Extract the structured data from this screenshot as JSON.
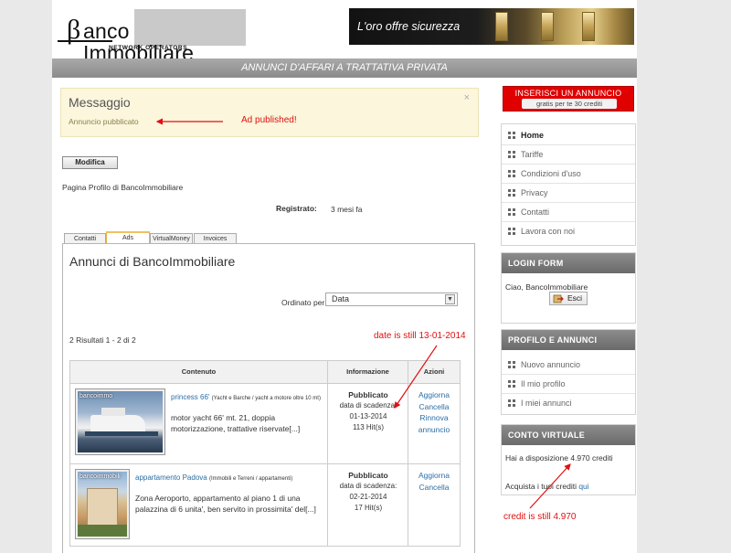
{
  "header": {
    "logo_b": "β",
    "logo_text": "anco Immobiliare",
    "logo_sub": "NETWORK OPERATORS",
    "banner_text": "L'oro offre sicurezza"
  },
  "page_title": "ANNUNCI D'AFFARI A TRATTATIVA PRIVATA",
  "message": {
    "title": "Messaggio",
    "text": "Annuncio pubblicato",
    "close": "×"
  },
  "annotations": {
    "published": "Ad published!",
    "date": "date is still 13-01-2014",
    "credit": "credit is still 4.970"
  },
  "profile": {
    "edit_button": "Modifica",
    "page_text": "Pagina Profilo di BancoImmobiliare",
    "registered_label": "Registrato:",
    "registered_value": "3 mesi fa"
  },
  "tabs": [
    {
      "label": "Contatti"
    },
    {
      "label": "Ads"
    },
    {
      "label": "VirtualMoney"
    },
    {
      "label": "Invoices"
    }
  ],
  "ads": {
    "title": "Annunci di BancoImmobiliare",
    "order_label": "Ordinato per",
    "order_value": "Data",
    "results": "2 Risultati 1 - 2 di 2",
    "headers": [
      "Contenuto",
      "Informazione",
      "Azioni"
    ],
    "rows": [
      {
        "watermark": "bancoimmo",
        "title": "princess 66'",
        "category": "(Yacht e Barche / yacht a motore oltre 10 mt)",
        "desc1": "motor yacht 66' mt. 21, doppia",
        "desc2": "motorizzazione, trattative riservate[...]",
        "status": "Pubblicato",
        "expiry_label": "data di scadenza:",
        "expiry": "01-13-2014",
        "hits": "113 Hit(s)",
        "actions": [
          "Aggiorna",
          "Cancella",
          "Rinnova",
          "annuncio"
        ]
      },
      {
        "watermark": "bancoimmobili",
        "title": "appartamento Padova",
        "category": "(Immobili e Terreni / appartamenti)",
        "desc1": "Zona Aeroporto, appartamento al piano 1 di una",
        "desc2": "palazzina di 6 unita', ben servito in prossimita' del[...]",
        "status": "Pubblicato",
        "expiry_label": "data di scadenza:",
        "expiry": "02-21-2014",
        "hits": "17 Hit(s)",
        "actions": [
          "Aggiorna",
          "Cancella"
        ]
      }
    ]
  },
  "sidebar": {
    "insert_title": "INSERISCI UN ANNUNCIO",
    "insert_sub": "gratis per te 30 crediti",
    "menu": [
      {
        "label": "Home"
      },
      {
        "label": "Tariffe"
      },
      {
        "label": "Condizioni d'uso"
      },
      {
        "label": "Privacy"
      },
      {
        "label": "Contatti"
      },
      {
        "label": "Lavora con noi"
      }
    ],
    "login_title": "LOGIN FORM",
    "login_greeting": "Ciao, BancoImmobiliare",
    "logout_button": "Esci",
    "profile_title": "PROFILO E ANNUNCI",
    "profile_menu": [
      {
        "label": "Nuovo annuncio"
      },
      {
        "label": "Il mio profilo"
      },
      {
        "label": "I miei annunci"
      }
    ],
    "virtual_title": "CONTO VIRTUALE",
    "credits_text": "Hai a disposizione 4.970 crediti",
    "buy_text": "Acquista i tuoi crediti",
    "buy_link": "qui"
  },
  "colors": {
    "accent_red": "#e00000",
    "link_blue": "#2a6fa6",
    "annotation_red": "#e01010"
  }
}
